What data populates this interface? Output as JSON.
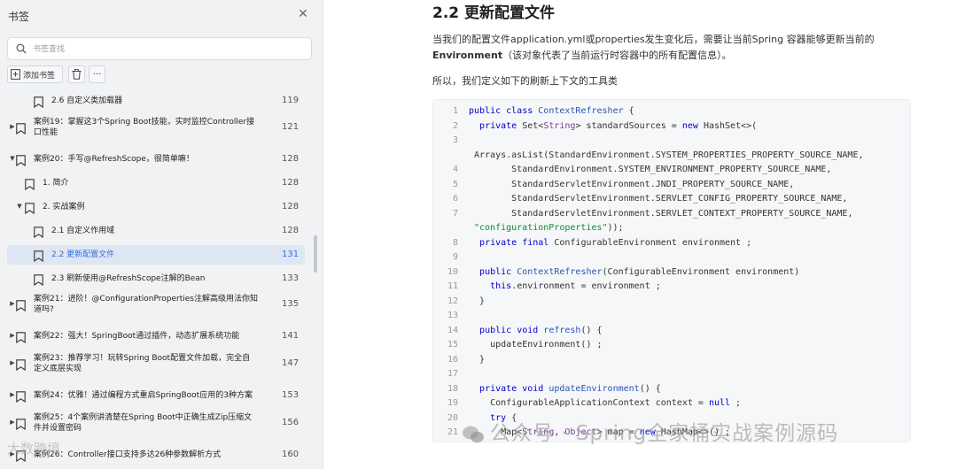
{
  "sidebar": {
    "title": "书签",
    "search_placeholder": "书签查找",
    "toolbar": {
      "add_label": "添加书签"
    },
    "items": [
      {
        "label": "2.6 自定义类加载器",
        "page": "119",
        "expand": "none",
        "level": 2
      },
      {
        "label_lines": [
          "案例19：掌握这3个Spring Boot技能，实时监控Controller接",
          "口性能"
        ],
        "page": "121",
        "expand": "collapsed",
        "level": 0
      },
      {
        "label": "案例20：手写@RefreshScope，很简单嘛！",
        "page": "128",
        "expand": "expanded",
        "level": 0
      },
      {
        "label": "1. 简介",
        "page": "128",
        "expand": "none",
        "level": 1
      },
      {
        "label": "2. 实战案例",
        "page": "128",
        "expand": "expanded",
        "level": 1
      },
      {
        "label": "2.1 自定义作用域",
        "page": "128",
        "expand": "none",
        "level": 2
      },
      {
        "label": "2.2 更新配置文件",
        "page": "131",
        "expand": "none",
        "level": 2,
        "active": true
      },
      {
        "label": "2.3 刷新使用@RefreshScope注解的Bean",
        "page": "133",
        "expand": "none",
        "level": 2
      },
      {
        "label_lines": [
          "案例21：进阶！@ConfigurationProperties注解高级用法你知",
          "道吗?"
        ],
        "page": "135",
        "expand": "collapsed",
        "level": 0
      },
      {
        "label": "案例22：强大！SpringBoot通过插件，动态扩展系统功能",
        "page": "141",
        "expand": "collapsed",
        "level": 0
      },
      {
        "label_lines": [
          "案例23：推荐学习！玩转Spring Boot配置文件加载，完全自",
          "定义底层实现"
        ],
        "page": "147",
        "expand": "collapsed",
        "level": 0
      },
      {
        "label": "案例24：优雅！通过编程方式重启SpringBoot应用的3种方案",
        "page": "153",
        "expand": "collapsed",
        "level": 0
      },
      {
        "label_lines": [
          "案例25：4个案例讲清楚在Spring Boot中正确生成Zip压缩文",
          "件并设置密码"
        ],
        "page": "156",
        "expand": "collapsed",
        "level": 0
      },
      {
        "label": "案例26：Controller接口支持多达26种参数解析方式",
        "page": "160",
        "expand": "collapsed",
        "level": 0
      }
    ]
  },
  "document": {
    "heading": "2.2 更新配置文件",
    "para1_line1": "当我们的配置文件application.yml或properties发生变化后，需要让当前Spring 容器能够更新当前的",
    "para1_bold": "Environment",
    "para1_line2_rest": "（该对象代表了当前运行时容器中的所有配置信息）。",
    "para2": "所以，我们定义如下的刷新上下文的工具类",
    "code_lines": [
      {
        "n": "1",
        "html": "<span class=\"kw\">public class</span> <span class=\"fn\">ContextRefresher</span> {"
      },
      {
        "n": "2",
        "html": "  <span class=\"kw\">private</span> Set&lt;<span class=\"ty\">String</span>&gt; standardSources = <span class=\"kw\">new</span> HashSet&lt;&gt;("
      },
      {
        "n": "3",
        "html": ""
      },
      {
        "n": "",
        "html": "Arrays.asList(StandardEnvironment.SYSTEM_PROPERTIES_PROPERTY_SOURCE_NAME,"
      },
      {
        "n": "4",
        "html": "        StandardEnvironment.SYSTEM_ENVIRONMENT_PROPERTY_SOURCE_NAME,"
      },
      {
        "n": "5",
        "html": "        StandardServletEnvironment.JNDI_PROPERTY_SOURCE_NAME,"
      },
      {
        "n": "6",
        "html": "        StandardServletEnvironment.SERVLET_CONFIG_PROPERTY_SOURCE_NAME,"
      },
      {
        "n": "7",
        "html": "        StandardServletEnvironment.SERVLET_CONTEXT_PROPERTY_SOURCE_NAME,"
      },
      {
        "n": "",
        "html": "<span class=\"st\">\"configurationProperties\"</span>));"
      },
      {
        "n": "8",
        "html": "  <span class=\"kw\">private final</span> ConfigurableEnvironment environment ;"
      },
      {
        "n": "9",
        "html": ""
      },
      {
        "n": "10",
        "html": "  <span class=\"kw\">public</span> <span class=\"fn\">ContextRefresher</span>(ConfigurableEnvironment environment)"
      },
      {
        "n": "11",
        "html": "    <span class=\"kw\">this</span>.environment = environment ;"
      },
      {
        "n": "12",
        "html": "  }"
      },
      {
        "n": "13",
        "html": ""
      },
      {
        "n": "14",
        "html": "  <span class=\"kw\">public void</span> <span class=\"fn\">refresh</span>() {"
      },
      {
        "n": "15",
        "html": "    updateEnvironment() ;"
      },
      {
        "n": "16",
        "html": "  }"
      },
      {
        "n": "17",
        "html": ""
      },
      {
        "n": "18",
        "html": "  <span class=\"kw\">private void</span> <span class=\"fn\">updateEnvironment</span>() {"
      },
      {
        "n": "19",
        "html": "    ConfigurableApplicationContext context = <span class=\"kw\">null</span> ;"
      },
      {
        "n": "20",
        "html": "    <span class=\"kw\">try</span> {"
      },
      {
        "n": "21",
        "html": "      Map&lt;<span class=\"ty\">String</span>, <span class=\"ty\">Object</span>&gt; map = <span class=\"kw\">new</span> HashMap&lt;&gt;() ;"
      }
    ]
  },
  "watermark": {
    "text": "公众号 · Spring全家桶实战案例源码",
    "left_text": "大数跨境"
  },
  "colors": {
    "sidebar_bg": "#f1f2f4",
    "active_row_bg": "#dfe6f3",
    "active_text": "#2d6ee0",
    "code_bg": "#f6f7f9",
    "keyword": "#0000cc"
  },
  "icons": [
    "search-icon",
    "close-icon",
    "bookmark-add-icon",
    "trash-icon",
    "more-icon",
    "bookmark-icon",
    "wechat-icon"
  ]
}
